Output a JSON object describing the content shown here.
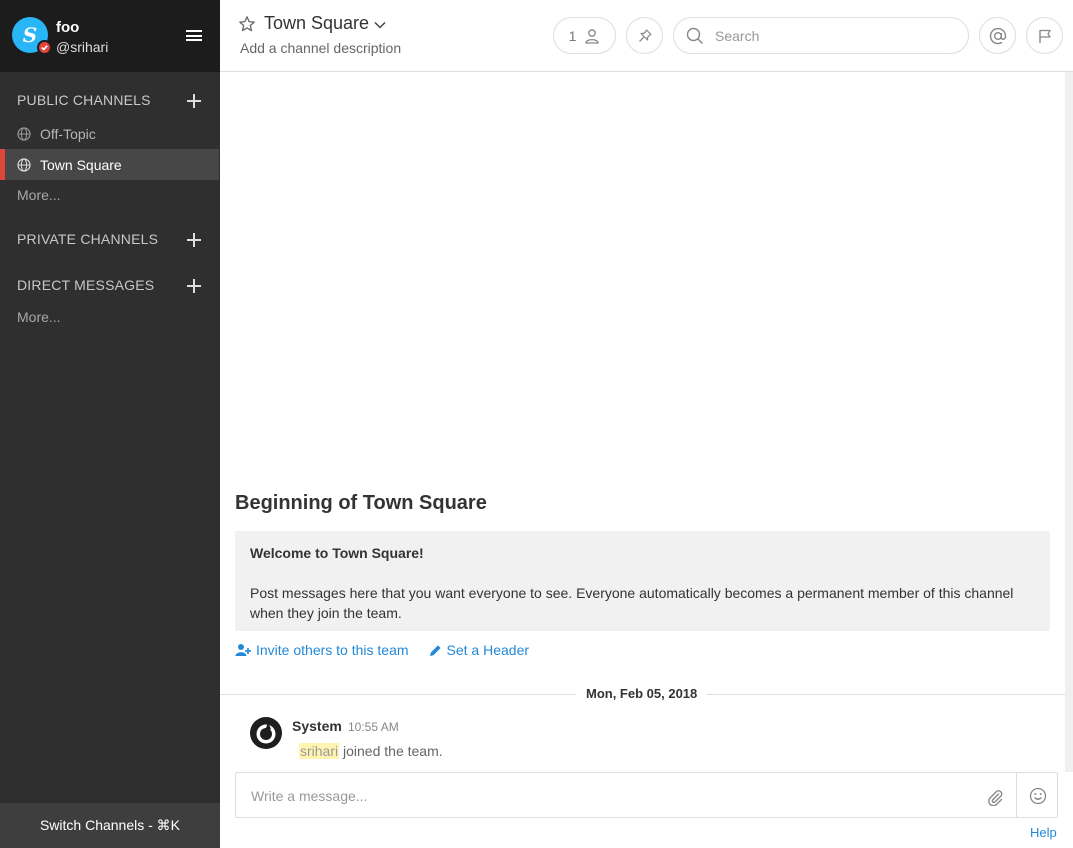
{
  "team": {
    "name": "foo",
    "user_handle": "@srihari",
    "avatar_initial": "S"
  },
  "sidebar": {
    "sections": {
      "public": {
        "title": "PUBLIC CHANNELS",
        "channels": [
          {
            "label": "Off-Topic",
            "active": false
          },
          {
            "label": "Town Square",
            "active": true
          }
        ],
        "more": "More..."
      },
      "private": {
        "title": "PRIVATE CHANNELS"
      },
      "direct": {
        "title": "DIRECT MESSAGES",
        "more": "More..."
      }
    },
    "switch_channels": "Switch Channels - ⌘K"
  },
  "header": {
    "channel_name": "Town Square",
    "channel_description": "Add a channel description",
    "member_count": "1",
    "search_placeholder": "Search"
  },
  "intro": {
    "title": "Beginning of Town Square",
    "welcome": "Welcome to Town Square!",
    "body": "Post messages here that you want everyone to see. Everyone automatically becomes a permanent member of this channel when they join the team.",
    "invite_label": "Invite others to this team",
    "set_header_label": "Set a Header"
  },
  "messages": {
    "date_separator": "Mon, Feb 05, 2018",
    "post": {
      "author": "System",
      "time": "10:55 AM",
      "mention": "srihari",
      "text": " joined the team."
    }
  },
  "composer": {
    "placeholder": "Write a message..."
  },
  "help": "Help",
  "colors": {
    "sidebar_bg": "#2f2f2f",
    "sidebar_header_bg": "#1c1c1c",
    "active_channel_accent": "#e0453c",
    "link": "#2389d7",
    "avatar": "#29b6f6",
    "mention_highlight": "#fff5b1"
  },
  "icons": [
    "hamburger-icon",
    "globe-icon",
    "plus-icon",
    "star-icon",
    "chevron-down-icon",
    "member-icon",
    "pin-icon",
    "search-icon",
    "at-mention-icon",
    "flag-icon",
    "add-user-icon",
    "pencil-icon",
    "attach-icon",
    "emoji-icon"
  ]
}
